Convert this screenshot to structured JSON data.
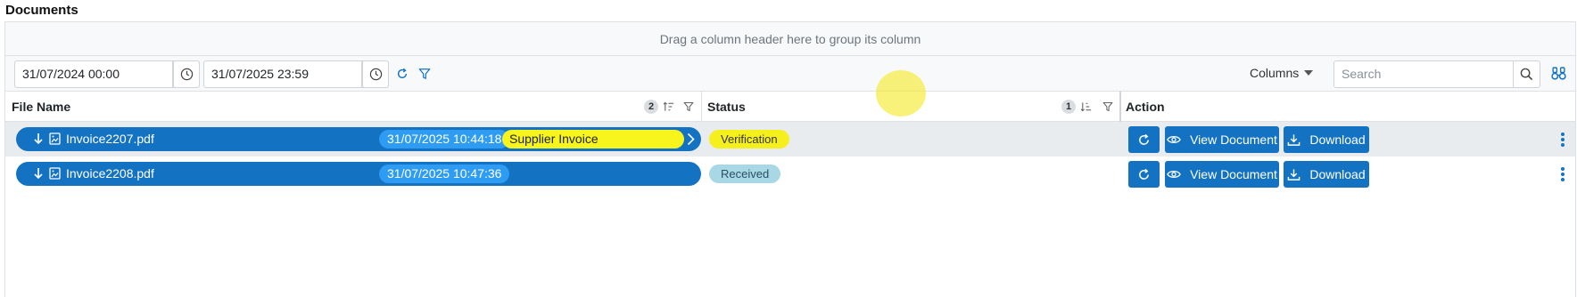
{
  "page": {
    "title": "Documents"
  },
  "grid": {
    "group_panel_text": "Drag a column header here to group its column",
    "toolbar": {
      "date_from": "31/07/2024 00:00",
      "date_to": "31/07/2025 23:59",
      "columns_label": "Columns",
      "search_placeholder": "Search"
    },
    "columns": [
      {
        "label": "File Name",
        "sort_order": "2"
      },
      {
        "label": "Status",
        "sort_order": "1"
      },
      {
        "label": "Action"
      }
    ],
    "rows": [
      {
        "file_name": "Invoice2207.pdf",
        "date": "31/07/2025 10:44:18",
        "tag": "Supplier Invoice",
        "status": "Verification",
        "selected": true
      },
      {
        "file_name": "Invoice2208.pdf",
        "date": "31/07/2025 10:47:36",
        "tag": "",
        "status": "Received",
        "selected": false
      }
    ],
    "actions": {
      "view_label": "View Document",
      "download_label": "Download"
    }
  },
  "colors": {
    "primary": "#1373c2",
    "date_pill": "#2e9cf3",
    "tag_yellow": "#f7f51c",
    "status_verification": "#f5f01c",
    "status_received": "#a8d8e6"
  },
  "icons": {
    "toolbar": [
      "calendar-icon",
      "clock-icon",
      "refresh-icon",
      "filter-icon",
      "caret-down-icon",
      "search-icon",
      "binoculars-icon"
    ],
    "row": [
      "down-arrow-icon",
      "image-file-icon",
      "chevron-right-icon",
      "refresh-icon",
      "eye-icon",
      "download-icon",
      "kebab-menu-icon"
    ]
  }
}
